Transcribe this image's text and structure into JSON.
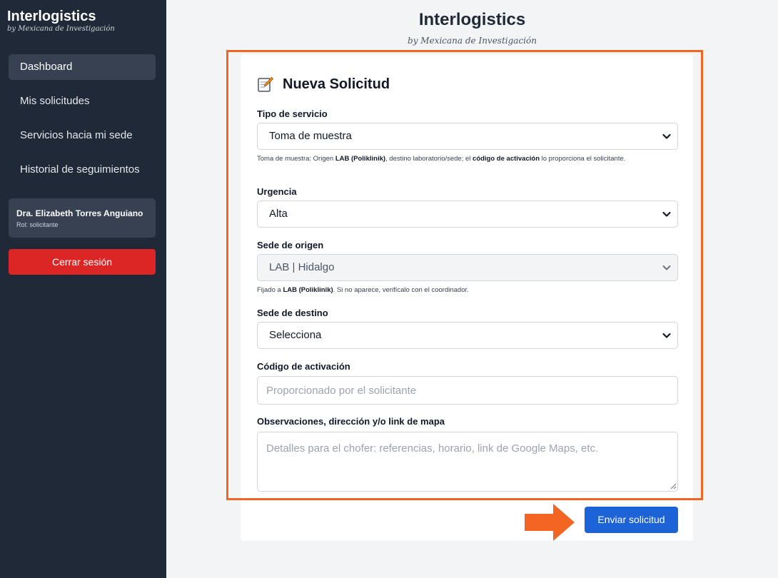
{
  "sidebar": {
    "brand": "Interlogistics",
    "brand_sub": "by Mexicana de Investigación",
    "items": [
      {
        "label": "Dashboard"
      },
      {
        "label": "Mis solicitudes"
      },
      {
        "label": "Servicios hacia mi sede"
      },
      {
        "label": "Historial de seguimientos"
      }
    ],
    "user": {
      "name": "Dra. Elizabeth Torres Anguiano",
      "role": "Rol: solicitante"
    },
    "logout_label": "Cerrar sesión"
  },
  "header": {
    "title": "Interlogistics",
    "subtitle": "by Mexicana de Investigación"
  },
  "form": {
    "title": "Nueva Solicitud",
    "title_icon": "memo-icon",
    "tipo": {
      "label": "Tipo de servicio",
      "value": "Toma de muestra",
      "help_1": "Toma de muestra: Origen ",
      "help_b1": "LAB (Poliklinik)",
      "help_2": ", destino laboratorio/sede; el ",
      "help_b2": "código de activación",
      "help_3": " lo proporciona el solicitante."
    },
    "urgencia": {
      "label": "Urgencia",
      "value": "Alta"
    },
    "origen": {
      "label": "Sede de origen",
      "value": "LAB | Hidalgo",
      "help_1": "Fijado a ",
      "help_b1": "LAB (Poliklinik)",
      "help_2": ". Si no aparece, verifícalo con el coordinador."
    },
    "destino": {
      "label": "Sede de destino",
      "value": "Selecciona"
    },
    "codigo": {
      "label": "Código de activación",
      "placeholder": "Proporcionado por el solicitante"
    },
    "observaciones": {
      "label": "Observaciones, dirección y/o link de mapa",
      "placeholder": "Detalles para el chofer: referencias, horario, link de Google Maps, etc."
    },
    "submit_label": "Enviar solicitud"
  },
  "colors": {
    "sidebar_bg": "#1f2937",
    "active_item": "#374151",
    "logout": "#dc2626",
    "submit": "#1d63d8",
    "highlight": "#f26522"
  }
}
